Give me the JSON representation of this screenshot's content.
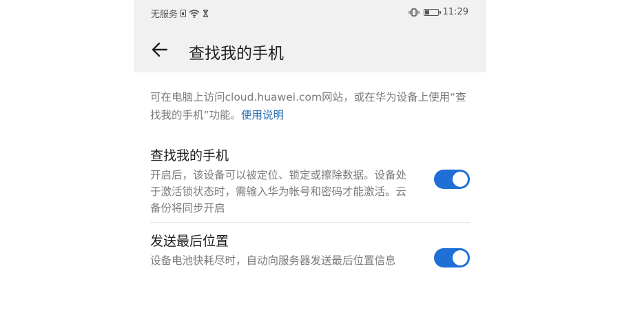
{
  "status_bar": {
    "carrier": "无服务",
    "time": "11:29",
    "battery_level": 0.3
  },
  "header": {
    "back_icon": "arrow-left-icon",
    "title": "查找我的手机"
  },
  "intro": {
    "text": "可在电脑上访问cloud.huawei.com网站，或在华为设备上使用“查找我的手机”功能。",
    "link": "使用说明"
  },
  "settings": [
    {
      "title": "查找我的手机",
      "description": "开启后，该设备可以被定位、锁定或擦除数据。设备处于激活锁状态时，需输入华为帐号和密码才能激活。云备份将同步开启",
      "enabled": true
    },
    {
      "title": "发送最后位置",
      "description": "设备电池快耗尽时，自动向服务器发送最后位置信息",
      "enabled": true
    }
  ],
  "colors": {
    "accent": "#1f6fd6",
    "link": "#2a6fb0",
    "topbar": "#f1f1f1"
  }
}
